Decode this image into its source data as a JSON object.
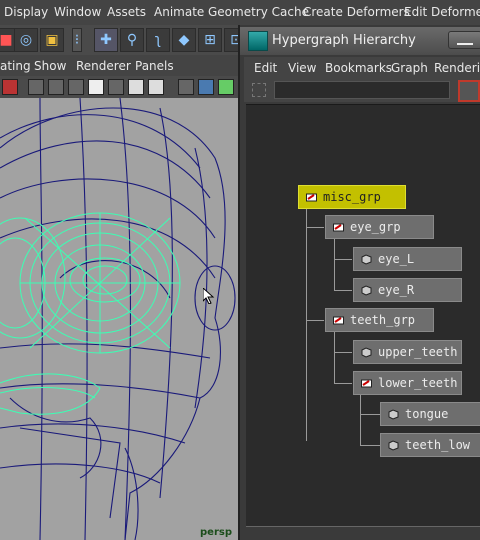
{
  "main_menu": [
    "Display",
    "Window",
    "Assets",
    "Animate",
    "Geometry Cache",
    "Create Deformers",
    "Edit Deformers"
  ],
  "panel_menu": [
    "ating",
    "Show",
    "Renderer",
    "Panels"
  ],
  "viewport": {
    "camera_label": "persp"
  },
  "hypergraph": {
    "title": "Hypergraph Hierarchy",
    "menu": [
      "Edit",
      "View",
      "Bookmarks",
      "Graph",
      "Rendering"
    ],
    "nodes": {
      "misc_grp": "misc_grp",
      "eye_grp": "eye_grp",
      "eye_L": "eye_L",
      "eye_R": "eye_R",
      "teeth_grp": "teeth_grp",
      "upper_teeth": "upper_teeth",
      "lower_teeth": "lower_teeth",
      "tongue": "tongue",
      "teeth_low": "teeth_low"
    }
  },
  "colors": {
    "selected_node": "#c3c000",
    "node": "#6e6e6e",
    "wire_blue": "#1a1a7a",
    "wire_green": "#3cffb4",
    "viewport_bg": "#a2a2a2"
  }
}
